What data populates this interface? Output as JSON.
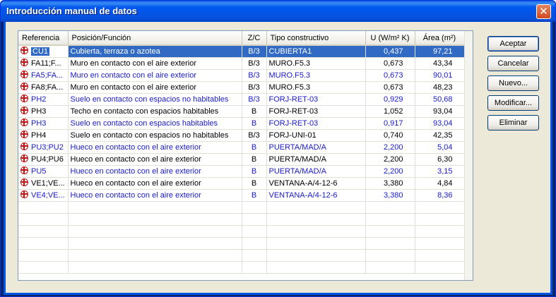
{
  "window": {
    "title": "Introducción manual de datos",
    "close_symbol": "✕"
  },
  "table": {
    "columns": [
      "Referencia",
      "Posición/Función",
      "Z/C",
      "Tipo constructivo",
      "U (W/m² K)",
      "Área (m²)"
    ],
    "rows": [
      {
        "ref": "CU1",
        "pos": "Cubierta, terraza o azotea",
        "zc": "B/3",
        "tipo": "CUBIERTA1",
        "u": "0,437",
        "area": "97,21",
        "selected": true,
        "blue": false
      },
      {
        "ref": "FA11;F...",
        "pos": "Muro en contacto con el aire exterior",
        "zc": "B/3",
        "tipo": "MURO.F5.3",
        "u": "0,673",
        "area": "43,34",
        "selected": false,
        "blue": false
      },
      {
        "ref": "FA5;FA...",
        "pos": "Muro en contacto con el aire exterior",
        "zc": "B/3",
        "tipo": "MURO.F5.3",
        "u": "0,673",
        "area": "90,01",
        "selected": false,
        "blue": true
      },
      {
        "ref": "FA8;FA...",
        "pos": "Muro en contacto con el aire exterior",
        "zc": "B/3",
        "tipo": "MURO.F5.3",
        "u": "0,673",
        "area": "48,23",
        "selected": false,
        "blue": false
      },
      {
        "ref": "PH2",
        "pos": "Suelo en contacto con espacios no habitables",
        "zc": "B/3",
        "tipo": "FORJ-RET-03",
        "u": "0,929",
        "area": "50,68",
        "selected": false,
        "blue": true
      },
      {
        "ref": "PH3",
        "pos": "Techo en contacto con espacios habitables",
        "zc": "B",
        "tipo": "FORJ-RET-03",
        "u": "1,052",
        "area": "93,04",
        "selected": false,
        "blue": false
      },
      {
        "ref": "PH3",
        "pos": "Suelo en contacto con espacios habitables",
        "zc": "B",
        "tipo": "FORJ-RET-03",
        "u": "0,917",
        "area": "93,04",
        "selected": false,
        "blue": true
      },
      {
        "ref": "PH4",
        "pos": "Suelo en contacto con espacios no habitables",
        "zc": "B/3",
        "tipo": "FORJ-UNI-01",
        "u": "0,740",
        "area": "42,35",
        "selected": false,
        "blue": false
      },
      {
        "ref": "PU3;PU2",
        "pos": "Hueco en contacto con el aire exterior",
        "zc": "B",
        "tipo": "PUERTA/MAD/A",
        "u": "2,200",
        "area": "5,04",
        "selected": false,
        "blue": true
      },
      {
        "ref": "PU4;PU6",
        "pos": "Hueco en contacto con el aire exterior",
        "zc": "B",
        "tipo": "PUERTA/MAD/A",
        "u": "2,200",
        "area": "6,30",
        "selected": false,
        "blue": false
      },
      {
        "ref": "PU5",
        "pos": "Hueco en contacto con el aire exterior",
        "zc": "B",
        "tipo": "PUERTA/MAD/A",
        "u": "2,200",
        "area": "3,15",
        "selected": false,
        "blue": true
      },
      {
        "ref": "VE1;VE...",
        "pos": "Hueco en contacto con el aire exterior",
        "zc": "B",
        "tipo": "VENTANA-A/4-12-6",
        "u": "3,380",
        "area": "4,84",
        "selected": false,
        "blue": false
      },
      {
        "ref": "VE4;VE...",
        "pos": "Hueco en contacto con el aire exterior",
        "zc": "B",
        "tipo": "VENTANA-A/4-12-6",
        "u": "3,380",
        "area": "8,36",
        "selected": false,
        "blue": true
      }
    ],
    "empty_rows": 6
  },
  "buttons": {
    "accept": "Aceptar",
    "cancel": "Cancelar",
    "new": "Nuevo...",
    "modify": "Modificar...",
    "delete": "Eliminar"
  },
  "colors": {
    "selection": "#316ac5",
    "blue_text": "#1a1acc",
    "row_icon": "#c41010"
  }
}
